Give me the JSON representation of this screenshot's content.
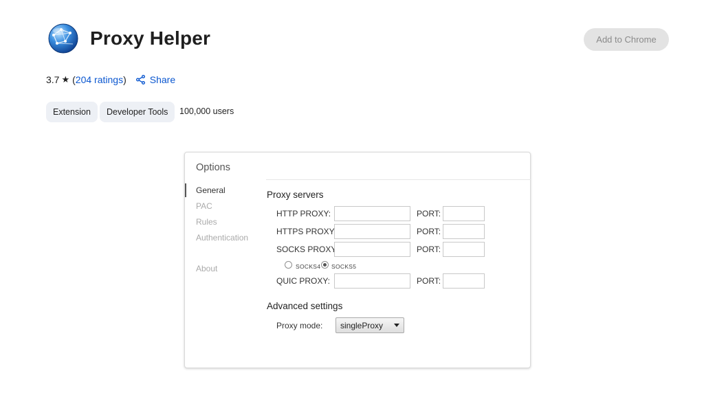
{
  "header": {
    "title": "Proxy Helper",
    "add_button": "Add to Chrome",
    "logo_icon": "globe-icon"
  },
  "meta": {
    "rating": "3.7",
    "star_icon": "star-icon",
    "ratings_text": "204 ratings",
    "share_label": "Share",
    "chips": [
      "Extension",
      "Developer Tools"
    ],
    "users": "100,000 users"
  },
  "options": {
    "title": "Options",
    "nav": [
      "General",
      "PAC",
      "Rules",
      "Authentication",
      "About"
    ],
    "selected_nav": "General",
    "proxy_servers_title": "Proxy servers",
    "http_label": "HTTP PROXY:",
    "https_label": "HTTPS PROXY:",
    "socks_label": "SOCKS PROXY:",
    "quic_label": "QUIC PROXY:",
    "port_label": "PORT:",
    "http_value": "",
    "https_value": "",
    "socks_value": "",
    "quic_value": "",
    "http_port": "",
    "https_port": "",
    "socks_port": "",
    "quic_port": "",
    "socks4_label": "SOCKS4",
    "socks5_label": "SOCKS5",
    "socks_selected": "SOCKS5",
    "advanced_title": "Advanced settings",
    "proxy_mode_label": "Proxy mode:",
    "proxy_mode_value": "singleProxy"
  },
  "colors": {
    "link": "#0b57d0",
    "chip_bg": "#edf0f5",
    "button_bg": "#e3e3e3"
  }
}
